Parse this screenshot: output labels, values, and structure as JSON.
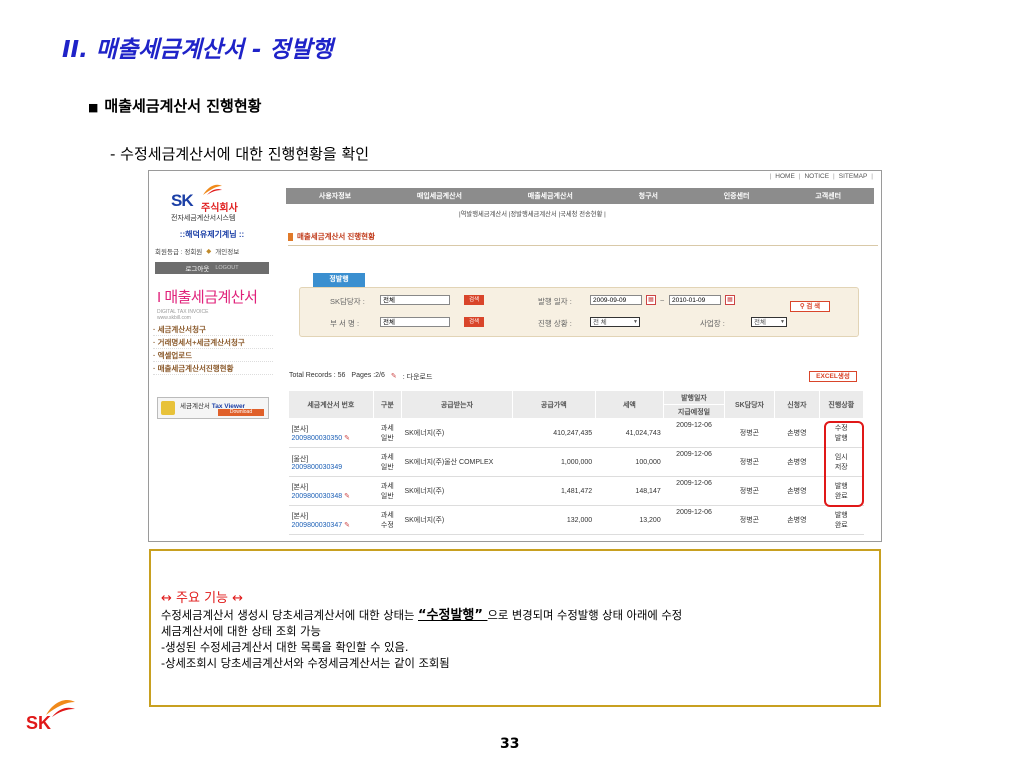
{
  "slide": {
    "title": "II. 매출세금계산서 - 정발행",
    "section": "매출세금계산서 진행현황",
    "sub": "- 수정세금계산서에 대한 진행현황을 확인",
    "page_number": "33"
  },
  "app": {
    "top_links": [
      "HOME",
      "NOTICE",
      "SITEMAP"
    ],
    "logo_sk": "SK",
    "logo_corp": "주식회사",
    "logo_sub": "전자세금계산서시스템",
    "nav": [
      "사용자정보",
      "매입세금계산서",
      "매출세금계산서",
      "청구서",
      "인증센터",
      "고객센터"
    ],
    "subnav": "|역발행세금계산서 |정발행세금계산서 |국세청 전송현황 |",
    "login": {
      "title": "::해덕유제기계님 ::",
      "grade": "회원등급 : 정회원",
      "info": "개인정보",
      "logout": "로그아웃",
      "logout_en": "LOGOUT"
    },
    "brand": {
      "main": "I 매출세금계산서",
      "en": "DIGITAL TAX INVOICE",
      "url": "www.skbill.com"
    },
    "lnb": [
      "· 세금계산서청구",
      "· 거래명세서+세금계산서청구",
      "· 엑셀업로드",
      "· 매출세금계산서진행현황"
    ],
    "viewer": {
      "label": "세금계산서",
      "brand": "Tax Viewer",
      "download": "Download"
    },
    "page_title": "매출세금계산서 진행현황",
    "tab": "정발행",
    "search": {
      "sk_owner_label": "SK담당자 :",
      "sk_owner_value": "전체",
      "dept_label": "부 서 명 :",
      "dept_value": "전체",
      "btn": "검색",
      "date_label": "발행 일자 :",
      "date_from": "2009-09-09",
      "date_to": "2010-01-09",
      "tilde": "~",
      "status_label": "진행 상황 :",
      "status_value": "전 체",
      "site_label": "사업장 :",
      "site_value": "전체",
      "search_btn": "검 색"
    },
    "records": {
      "total": "Total Records : 56",
      "pages": "Pages :2/6",
      "download": ": 다운로드"
    },
    "excel": "EXCEL생성",
    "table": {
      "headers": {
        "inv_no": "세금계산서 번호",
        "type": "구분",
        "buyer": "공급받는자",
        "supply": "공급가액",
        "tax": "세액",
        "issue_date": "발행일자",
        "plan_date": "지급예정일",
        "sk_owner": "SK담당자",
        "requester": "신청자",
        "status": "진행상황"
      },
      "rows": [
        {
          "loc": "[본사]",
          "no": "2009800030350",
          "type1": "과세",
          "type2": "일반",
          "buyer": "SK에너지(주)",
          "supply": "410,247,435",
          "tax": "41,024,743",
          "date": "2009-12-06",
          "owner": "정병곤",
          "req": "손병영",
          "status1": "수정",
          "status2": "발행"
        },
        {
          "loc": "[울산]",
          "no": "2009800030349",
          "type1": "과세",
          "type2": "일반",
          "buyer": "SK에너지(주)울산 COMPLEX",
          "supply": "1,000,000",
          "tax": "100,000",
          "date": "2009-12-06",
          "owner": "정병곤",
          "req": "손병영",
          "status1": "임시",
          "status2": "저장"
        },
        {
          "loc": "[본사]",
          "no": "2009800030348",
          "type1": "과세",
          "type2": "일반",
          "buyer": "SK에너지(주)",
          "supply": "1,481,472",
          "tax": "148,147",
          "date": "2009-12-06",
          "owner": "정병곤",
          "req": "손병영",
          "status1": "발행",
          "status2": "완료"
        },
        {
          "loc": "[본사]",
          "no": "2009800030347",
          "type1": "과세",
          "type2": "수정",
          "buyer": "SK에너지(주)",
          "supply": "132,000",
          "tax": "13,200",
          "date": "2009-12-06",
          "owner": "정병곤",
          "req": "손병영",
          "status1": "발행",
          "status2": "완료"
        }
      ]
    }
  },
  "note": {
    "title": "↔ 주요 기능 ↔",
    "line1_pre": "수정세금계산서 생성시 당초세금계산서에 대한 상태는 ",
    "line1_bold": "“수정발행” ",
    "line1_post": "으로 변경되며 수정발행 상태 아래에 수정",
    "line2": "세금계산서에 대한 상태 조회 가능",
    "line3": "-생성된 수정세금계산서 대한 목록을 확인할 수 있음.",
    "line4": "-상세조회시 당초세금계산서와 수정세금계산서는 같이 조회됨"
  },
  "footer": {
    "logo": "SK"
  }
}
